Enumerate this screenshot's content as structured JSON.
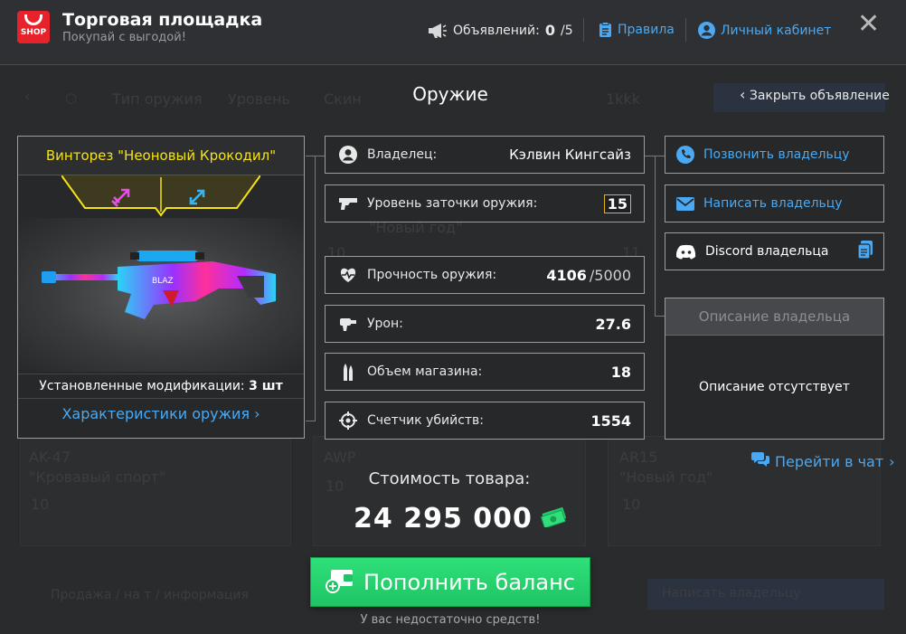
{
  "header": {
    "logo_text": "SHOP",
    "title": "Торговая площадка",
    "subtitle": "Покупай с выгодой!",
    "ads_label": "Объявлений:",
    "ads_count": "0",
    "ads_max": "/5",
    "rules": "Правила",
    "account": "Личный кабинет"
  },
  "background": {
    "filters": [
      "Тип оружия",
      "Уровень",
      "Скин"
    ],
    "fragment": "1kkk",
    "cards": [
      {
        "name": "AK-47",
        "skin": "\"Кровавый спорт\"",
        "level": "10"
      },
      {
        "name": "AWP",
        "skin": "",
        "level": "10"
      },
      {
        "name": "AR15",
        "skin": "\"Новый год\"",
        "level": "10"
      }
    ],
    "mid_texts": [
      "\"Новый год\"",
      "10",
      "11"
    ],
    "bottom_left": "Продажа / на т / информация",
    "bottom_right": "Написать владельцу"
  },
  "section": {
    "title": "Оружие",
    "close_ad": "Закрыть объявление"
  },
  "weapon": {
    "name": "Винторез \"Неоновый Крокодил\"",
    "mods_label": "Установленные модификации:",
    "mods_count": "3 шт",
    "chars_link": "Характеристики оружия"
  },
  "stats": {
    "owner_label": "Владелец:",
    "owner_value": "Кэлвин Кингсайз",
    "level_label": "Уровень заточки оружия:",
    "level_value": "15",
    "durability_label": "Прочность оружия:",
    "durability_value": "4106",
    "durability_max": "/5000",
    "damage_label": "Урон:",
    "damage_value": "27.6",
    "magazine_label": "Объем магазина:",
    "magazine_value": "18",
    "kills_label": "Счетчик убийств:",
    "kills_value": "1554"
  },
  "actions": {
    "call": "Позвонить владельцу",
    "write": "Написать владельцу",
    "discord": "Discord владельца",
    "desc_head": "Описание владельца",
    "desc_body": "Описание отсутствует",
    "chat": "Перейти в чат"
  },
  "purchase": {
    "price_label": "Стоимость товара:",
    "price": "24 295 000",
    "topup": "Пополнить баланс",
    "no_funds": "У вас недостаточно средств!"
  },
  "colors": {
    "accent_blue": "#4aa9f2",
    "accent_yellow": "#f4e21a",
    "accent_green": "#1fc464",
    "brand_red": "#e8222a"
  }
}
